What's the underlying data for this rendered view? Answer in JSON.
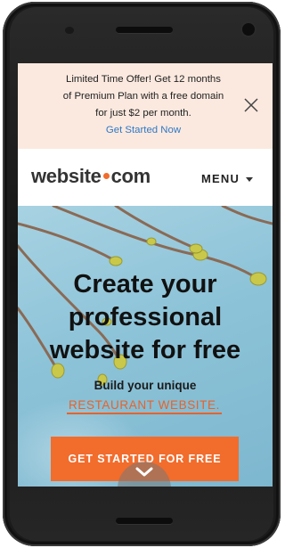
{
  "promo": {
    "lines": [
      "Limited Time Offer! Get 12 months",
      "of Premium Plan with a free domain",
      "for just $2 per month."
    ],
    "link": "Get Started Now"
  },
  "header": {
    "logo_left": "website",
    "logo_right": "com",
    "menu_label": "MENU"
  },
  "hero": {
    "title_lines": [
      "Create your",
      "professional",
      "website for free"
    ],
    "subtitle": "Build your unique",
    "highlight": "RESTAURANT WEBSITE.",
    "cta_label": "GET STARTED FOR FREE"
  },
  "colors": {
    "accent": "#f26c2c",
    "promo_bg": "#fbe9df",
    "link": "#2e78c6",
    "hero_bg": "#8dc3d8"
  },
  "icons": [
    "close-icon",
    "caret-down-icon",
    "chevron-down-icon",
    "logo-dot-icon"
  ]
}
